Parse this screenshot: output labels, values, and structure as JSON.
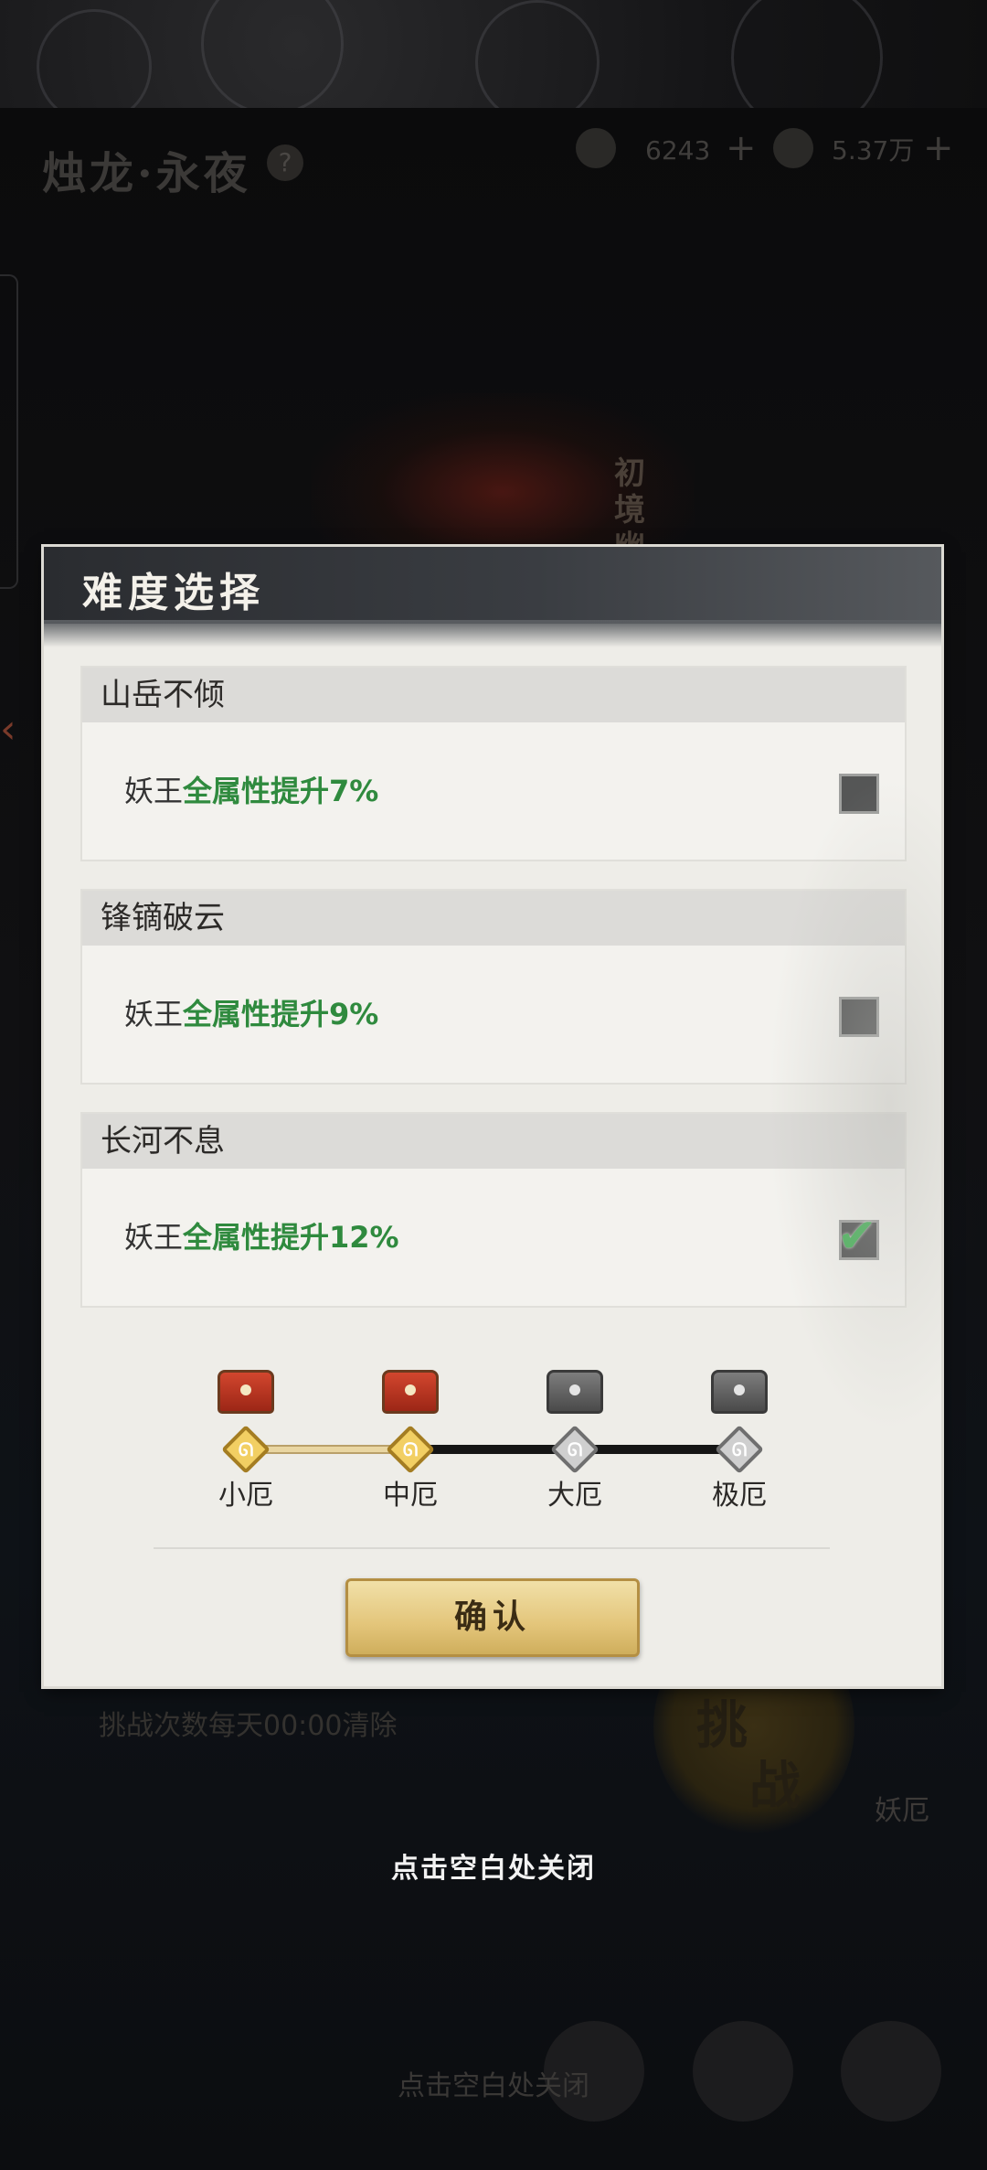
{
  "background": {
    "title": "烛龙·永夜",
    "help_icon": "?",
    "resources": [
      {
        "icon": "jade-icon",
        "value": "6243"
      },
      {
        "icon": "leaf-icon",
        "value": "5.37万"
      }
    ],
    "plus": "+",
    "scene_vertical_text": "初境幽冥",
    "clear_notice": "挑战次数每天00:00清除",
    "challenge_label_1": "挑",
    "challenge_label_2": "战",
    "yao_label": "妖厄",
    "close_hint_behind": "点击空白处关闭"
  },
  "dialog": {
    "title": "难度选择",
    "options": [
      {
        "name": "山岳不倾",
        "desc_prefix": "妖王",
        "desc_highlight": "全属性提升7%",
        "checked": false
      },
      {
        "name": "锋镝破云",
        "desc_prefix": "妖王",
        "desc_highlight": "全属性提升9%",
        "checked": false
      },
      {
        "name": "长河不息",
        "desc_prefix": "妖王",
        "desc_highlight": "全属性提升12%",
        "checked": true
      }
    ],
    "levels": [
      "小厄",
      "中厄",
      "大厄",
      "极厄"
    ],
    "level_reached": 2,
    "confirm_label": "确认",
    "colors": {
      "highlight": "#2f8a3e",
      "check": "#49b15a",
      "gold": "#e3c57a"
    }
  },
  "close_hint": "点击空白处关闭"
}
